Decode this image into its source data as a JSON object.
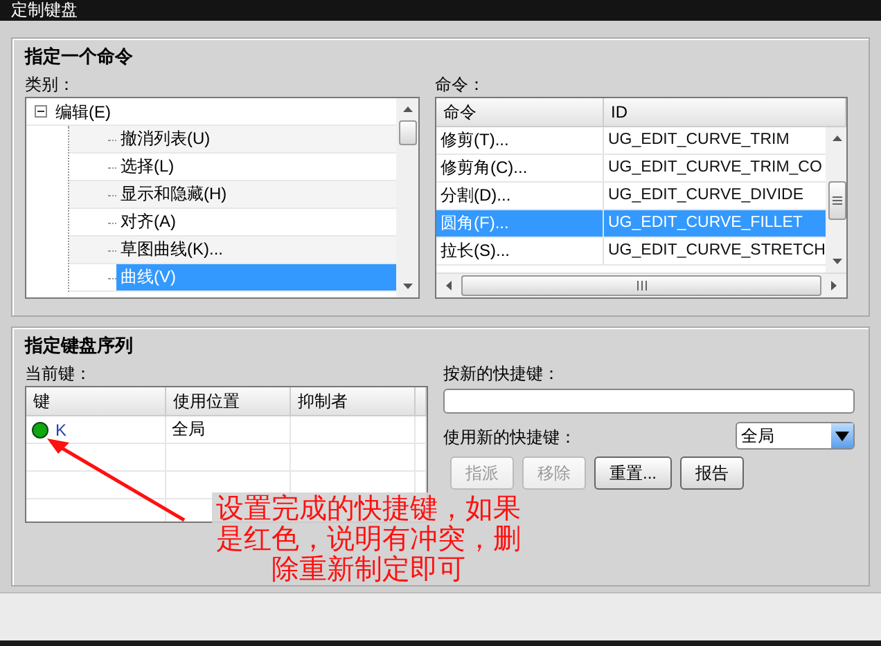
{
  "window": {
    "title": "定制键盘"
  },
  "assign_command": {
    "title": "指定一个命令",
    "category_label": "类别：",
    "categories": [
      {
        "label": "编辑(E)",
        "expanded": true,
        "selected": false,
        "children": [
          {
            "label": "撤消列表(U)",
            "selected": false
          },
          {
            "label": "选择(L)",
            "selected": false
          },
          {
            "label": "显示和隐藏(H)",
            "selected": false
          },
          {
            "label": "对齐(A)",
            "selected": false
          },
          {
            "label": "草图曲线(K)...",
            "selected": false
          },
          {
            "label": "曲线(V)",
            "selected": true
          }
        ]
      }
    ],
    "commands_label": "命令：",
    "commands_table": {
      "columns": [
        "命令",
        "ID"
      ],
      "rows": [
        {
          "name": "修剪(T)...",
          "id": "UG_EDIT_CURVE_TRIM",
          "selected": false
        },
        {
          "name": "修剪角(C)...",
          "id": "UG_EDIT_CURVE_TRIM_CO",
          "selected": false
        },
        {
          "name": "分割(D)...",
          "id": "UG_EDIT_CURVE_DIVIDE",
          "selected": false
        },
        {
          "name": "圆角(F)...",
          "id": "UG_EDIT_CURVE_FILLET",
          "selected": true
        },
        {
          "name": "拉长(S)...",
          "id": "UG_EDIT_CURVE_STRETCH",
          "selected": false
        }
      ]
    }
  },
  "key_sequence": {
    "title": "指定键盘序列",
    "current_keys_label": "当前键：",
    "keys_table": {
      "columns": [
        "键",
        "使用位置",
        "抑制者"
      ],
      "rows": [
        {
          "key": "K",
          "color": "#10a810",
          "used_in": "全局"
        }
      ]
    },
    "new_key_label": "按新的快捷键：",
    "use_label": "使用新的快捷键：",
    "scope_dropdown": {
      "value": "全局"
    },
    "buttons": [
      {
        "label": "指派",
        "disabled": true
      },
      {
        "label": "移除",
        "disabled": true
      },
      {
        "label": "重置...",
        "disabled": false
      },
      {
        "label": "报告",
        "disabled": false
      }
    ]
  },
  "annotation": {
    "text": "设置完成的快捷键，如果是红色，说明有冲突，删除重新制定即可"
  }
}
